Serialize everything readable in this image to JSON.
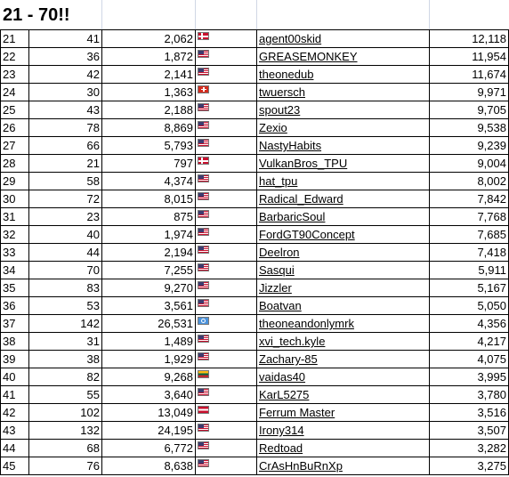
{
  "sheet": {
    "title": "21 - 70!!",
    "rows": [
      {
        "rank": "21",
        "a": "41",
        "b": "2,062",
        "flag": "dk",
        "user": "agent00skid",
        "score": "12,118"
      },
      {
        "rank": "22",
        "a": "36",
        "b": "1,872",
        "flag": "us",
        "user": "GREASEMONKEY",
        "score": "11,954"
      },
      {
        "rank": "23",
        "a": "42",
        "b": "2,141",
        "flag": "us",
        "user": "theonedub",
        "score": "11,674"
      },
      {
        "rank": "24",
        "a": "30",
        "b": "1,363",
        "flag": "ch",
        "user": "twuersch",
        "score": "9,971"
      },
      {
        "rank": "25",
        "a": "43",
        "b": "2,188",
        "flag": "us",
        "user": "spout23",
        "score": "9,705"
      },
      {
        "rank": "26",
        "a": "78",
        "b": "8,869",
        "flag": "us",
        "user": "Zexio",
        "score": "9,538"
      },
      {
        "rank": "27",
        "a": "66",
        "b": "5,793",
        "flag": "us",
        "user": "NastyHabits",
        "score": "9,239"
      },
      {
        "rank": "28",
        "a": "21",
        "b": "797",
        "flag": "dk",
        "user": "VulkanBros_TPU",
        "score": "9,004"
      },
      {
        "rank": "29",
        "a": "58",
        "b": "4,374",
        "flag": "us",
        "user": "hat_tpu",
        "score": "8,002"
      },
      {
        "rank": "30",
        "a": "72",
        "b": "8,015",
        "flag": "us",
        "user": "Radical_Edward",
        "score": "7,842"
      },
      {
        "rank": "31",
        "a": "23",
        "b": "875",
        "flag": "us",
        "user": "BarbaricSoul",
        "score": "7,768"
      },
      {
        "rank": "32",
        "a": "40",
        "b": "1,974",
        "flag": "us",
        "user": "FordGT90Concept",
        "score": "7,685"
      },
      {
        "rank": "33",
        "a": "44",
        "b": "2,194",
        "flag": "us",
        "user": "Deelron",
        "score": "7,418"
      },
      {
        "rank": "34",
        "a": "70",
        "b": "7,255",
        "flag": "us",
        "user": "Sasqui",
        "score": "5,911"
      },
      {
        "rank": "35",
        "a": "83",
        "b": "9,270",
        "flag": "us",
        "user": "Jizzler",
        "score": "5,167"
      },
      {
        "rank": "36",
        "a": "53",
        "b": "3,561",
        "flag": "us",
        "user": "Boatvan",
        "score": "5,050"
      },
      {
        "rank": "37",
        "a": "142",
        "b": "26,531",
        "flag": "un",
        "user": "theoneandonlymrk",
        "score": "4,356"
      },
      {
        "rank": "38",
        "a": "31",
        "b": "1,489",
        "flag": "us",
        "user": "xvi_tech.kyle",
        "score": "4,217"
      },
      {
        "rank": "39",
        "a": "38",
        "b": "1,929",
        "flag": "us",
        "user": "Zachary-85",
        "score": "4,075"
      },
      {
        "rank": "40",
        "a": "82",
        "b": "9,268",
        "flag": "lt",
        "user": "vaidas40",
        "score": "3,995"
      },
      {
        "rank": "41",
        "a": "55",
        "b": "3,640",
        "flag": "us",
        "user": "KarL5275",
        "score": "3,780"
      },
      {
        "rank": "42",
        "a": "102",
        "b": "13,049",
        "flag": "at",
        "user": "Ferrum Master",
        "score": "3,516"
      },
      {
        "rank": "43",
        "a": "132",
        "b": "24,195",
        "flag": "us",
        "user": "Irony314",
        "score": "3,507"
      },
      {
        "rank": "44",
        "a": "68",
        "b": "6,772",
        "flag": "us",
        "user": "Redtoad",
        "score": "3,282"
      },
      {
        "rank": "45",
        "a": "76",
        "b": "8,638",
        "flag": "us",
        "user": "CrAsHnBuRnXp",
        "score": "3,275"
      }
    ]
  }
}
